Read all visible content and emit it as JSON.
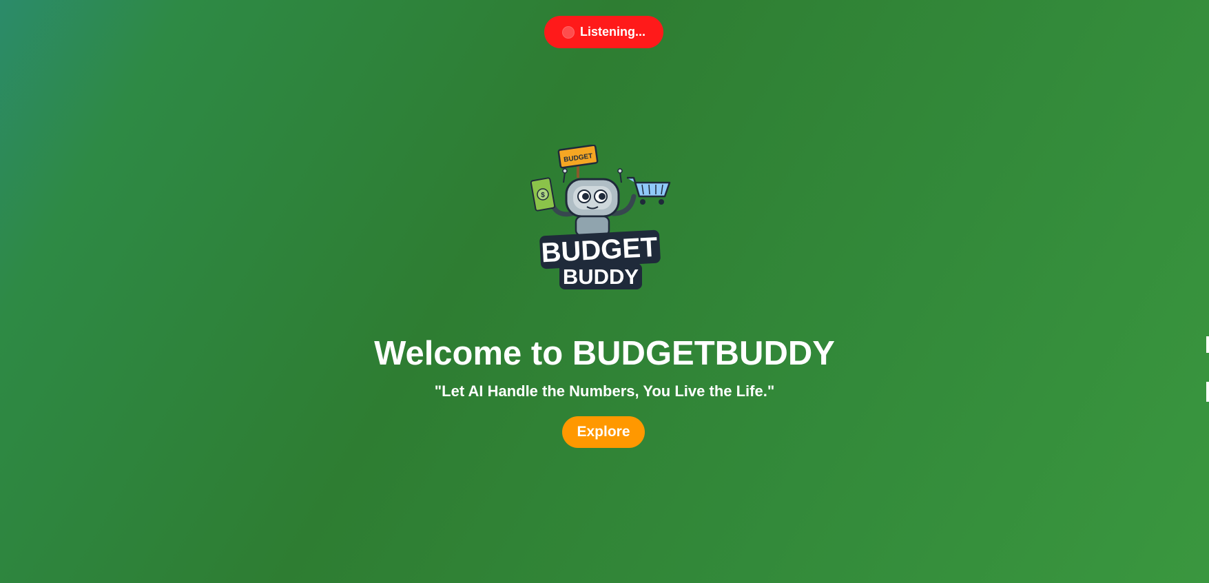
{
  "status": {
    "listening_label": "Listening...",
    "indicator_color": "#ff1a1a"
  },
  "logo": {
    "sign_text": "BUDGET",
    "wordmark_line1": "BUDGET",
    "wordmark_line2": "BUDDY",
    "icons": [
      "robot-icon",
      "money-bill-icon",
      "shopping-cart-icon"
    ]
  },
  "hero": {
    "title": "Welcome to BUDGETBUDDY",
    "tagline": "\"Let AI Handle the Numbers, You Live the Life.\"",
    "explore_label": "Explore"
  },
  "colors": {
    "background_start": "#2c8b6a",
    "background_main": "#2e7d32",
    "background_end": "#3a973f",
    "accent": "#ff9800",
    "recording": "#ff1a1a"
  }
}
